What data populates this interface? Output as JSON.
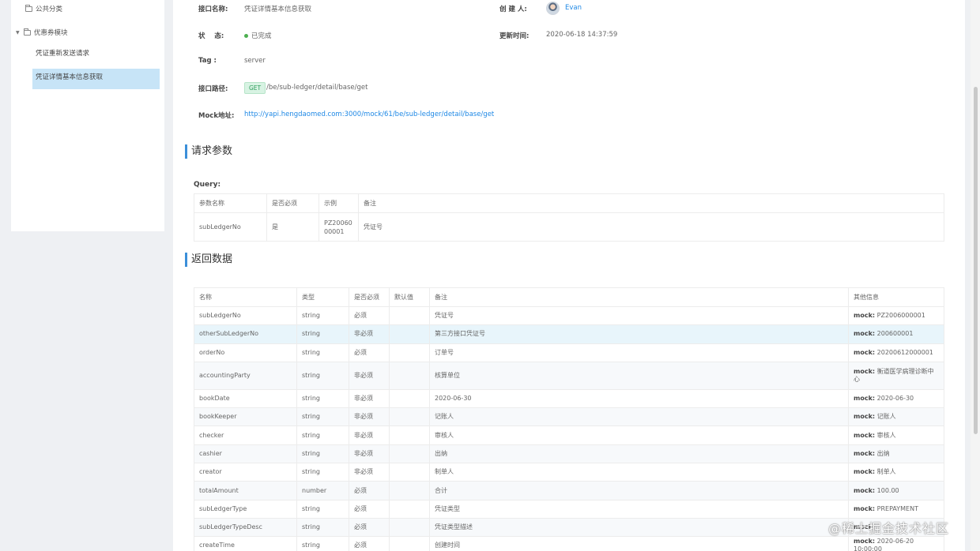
{
  "sidebar": {
    "nodes": [
      {
        "label": "公共分类"
      },
      {
        "label": "优惠券模块"
      }
    ],
    "items": [
      {
        "label": "凭证重新发送请求"
      },
      {
        "label": "凭证详情基本信息获取"
      }
    ]
  },
  "info": {
    "name_label": "接口名称:",
    "name_value": "凭证详情基本信息获取",
    "creator_label": "创 建 人:",
    "creator_value": "Evan",
    "status_label": "状    态:",
    "status_value": "已完成",
    "updated_label": "更新时间:",
    "updated_value": "2020-06-18 14:37:59",
    "tag_label": "Tag :",
    "tag_value": "server",
    "path_label": "接口路径:",
    "method": "GET",
    "path_value": "/be/sub-ledger/detail/base/get",
    "mock_label": "Mock地址:",
    "mock_url": "http://yapi.hengdaomed.com:3000/mock/61/be/sub-ledger/detail/base/get"
  },
  "request": {
    "title": "请求参数",
    "query_label": "Query:",
    "headers": [
      "参数名称",
      "是否必须",
      "示例",
      "备注"
    ],
    "rows": [
      {
        "name": "subLedgerNo",
        "required": "是",
        "example": "PZ2006000001",
        "note": "凭证号"
      }
    ]
  },
  "response": {
    "title": "返回数据",
    "headers": [
      "名称",
      "类型",
      "是否必须",
      "默认值",
      "备注",
      "其他信息"
    ],
    "mock_key": "mock:",
    "rows": [
      {
        "name": "subLedgerNo",
        "type": "string",
        "required": "必须",
        "default": "",
        "note": "凭证号",
        "mock": "PZ2006000001"
      },
      {
        "name": "otherSubLedgerNo",
        "type": "string",
        "required": "非必须",
        "default": "",
        "note": "第三方接口凭证号",
        "mock": "200600001"
      },
      {
        "name": "orderNo",
        "type": "string",
        "required": "必须",
        "default": "",
        "note": "订单号",
        "mock": "20200612000001"
      },
      {
        "name": "accountingParty",
        "type": "string",
        "required": "非必须",
        "default": "",
        "note": "核算单位",
        "mock": "衡道医学病理诊断中心"
      },
      {
        "name": "bookDate",
        "type": "string",
        "required": "非必须",
        "default": "",
        "note": "2020-06-30",
        "mock": "2020-06-30"
      },
      {
        "name": "bookKeeper",
        "type": "string",
        "required": "非必须",
        "default": "",
        "note": "记账人",
        "mock": "记账人"
      },
      {
        "name": "checker",
        "type": "string",
        "required": "非必须",
        "default": "",
        "note": "审核人",
        "mock": "审核人"
      },
      {
        "name": "cashier",
        "type": "string",
        "required": "非必须",
        "default": "",
        "note": "出纳",
        "mock": "出纳"
      },
      {
        "name": "creator",
        "type": "string",
        "required": "非必须",
        "default": "",
        "note": "制单人",
        "mock": "制单人"
      },
      {
        "name": "totalAmount",
        "type": "number",
        "required": "必须",
        "default": "",
        "note": "合计",
        "mock": "100.00"
      },
      {
        "name": "subLedgerType",
        "type": "string",
        "required": "必须",
        "default": "",
        "note": "凭证类型",
        "mock": "PREPAYMENT"
      },
      {
        "name": "subLedgerTypeDesc",
        "type": "string",
        "required": "必须",
        "default": "",
        "note": "凭证类型描述",
        "mock": ""
      },
      {
        "name": "createTime",
        "type": "string",
        "required": "必须",
        "default": "",
        "note": "创建时间",
        "mock": "2020-06-20 10:00:00"
      }
    ]
  },
  "watermark": "@稀土掘金技术社区",
  "colors": {
    "accent": "#1e88e5",
    "active_bg": "#c7e4f7",
    "get_tag": "#2e9d5c"
  }
}
